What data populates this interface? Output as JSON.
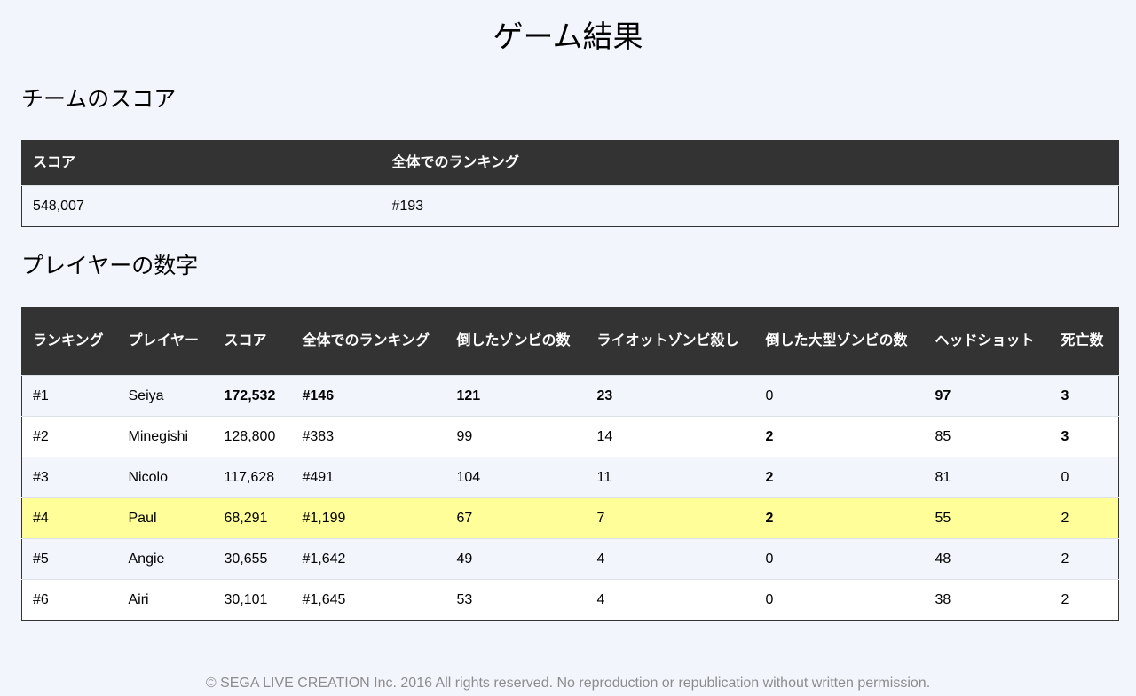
{
  "page": {
    "title": "ゲーム結果"
  },
  "team": {
    "title": "チームのスコア",
    "headers": [
      "スコア",
      "全体でのランキング"
    ],
    "score": "548,007",
    "ranking": "#193"
  },
  "players": {
    "title": "プレイヤーの数字",
    "headers": [
      "ランキング",
      "プレイヤー",
      "スコア",
      "全体でのランキング",
      "倒したゾンビの数",
      "ライオットゾンビ殺し",
      "倒した大型ゾンビの数",
      "ヘッドショット",
      "死亡数"
    ],
    "rows": [
      {
        "rank": "#1",
        "name": "Seiya",
        "score": "172,532",
        "overall": "#146",
        "zombies": "121",
        "riot": "23",
        "big": "0",
        "headshots": "97",
        "deaths": "3"
      },
      {
        "rank": "#2",
        "name": "Minegishi",
        "score": "128,800",
        "overall": "#383",
        "zombies": "99",
        "riot": "14",
        "big": "2",
        "headshots": "85",
        "deaths": "3"
      },
      {
        "rank": "#3",
        "name": "Nicolo",
        "score": "117,628",
        "overall": "#491",
        "zombies": "104",
        "riot": "11",
        "big": "2",
        "headshots": "81",
        "deaths": "0"
      },
      {
        "rank": "#4",
        "name": "Paul",
        "score": "68,291",
        "overall": "#1,199",
        "zombies": "67",
        "riot": "7",
        "big": "2",
        "headshots": "55",
        "deaths": "2"
      },
      {
        "rank": "#5",
        "name": "Angie",
        "score": "30,655",
        "overall": "#1,642",
        "zombies": "49",
        "riot": "4",
        "big": "0",
        "headshots": "48",
        "deaths": "2"
      },
      {
        "rank": "#6",
        "name": "Airi",
        "score": "30,101",
        "overall": "#1,645",
        "zombies": "53",
        "riot": "4",
        "big": "0",
        "headshots": "38",
        "deaths": "2"
      }
    ]
  },
  "footer": {
    "copyright": "© SEGA LIVE CREATION Inc. 2016 All rights reserved. No reproduction or republication without written permission."
  },
  "colors": {
    "header_bg": "#333333",
    "page_bg": "#f2f5fc",
    "highlight_row": "#fffe99",
    "footer_text": "#8c8c8c"
  }
}
